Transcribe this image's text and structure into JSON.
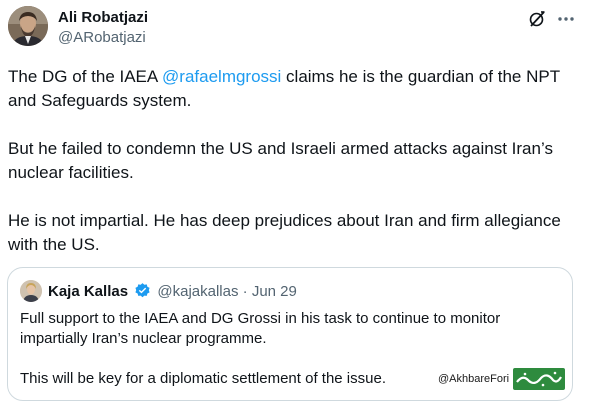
{
  "author": {
    "name": "Ali Robatjazi",
    "handle": "@ARobatjazi"
  },
  "icons": {
    "grok": "grok-icon",
    "more": "more-horizontal-icon",
    "verified": "verified-badge-icon"
  },
  "tweet": {
    "p1_before": "The DG of the IAEA ",
    "p1_mention": "@rafaelmgrossi",
    "p1_after": " claims he is the guardian of the NPT and Safeguards system.",
    "p2": "But he failed to condemn the US and Israeli armed attacks against Iran’s nuclear facilities.",
    "p3": "He is not impartial. He has deep prejudices about Iran and firm allegiance with the US."
  },
  "quote": {
    "name": "Kaja Kallas",
    "handle": "@kajakallas",
    "separator": "·",
    "date": "Jun 29",
    "p1": "Full support to the IAEA and DG Grossi in his task to continue to monitor impartially Iran’s nuclear programme.",
    "p2": "This will be key for a diplomatic settlement of the issue."
  },
  "watermark": {
    "handle": "@AkhbareFori",
    "logo_text": "خبر فوری"
  },
  "colors": {
    "text": "#0f1419",
    "secondary": "#536471",
    "link": "#1d9bf0",
    "border": "#cfd9de",
    "verified": "#1d9bf0",
    "watermark_green": "#2e8b3e"
  }
}
